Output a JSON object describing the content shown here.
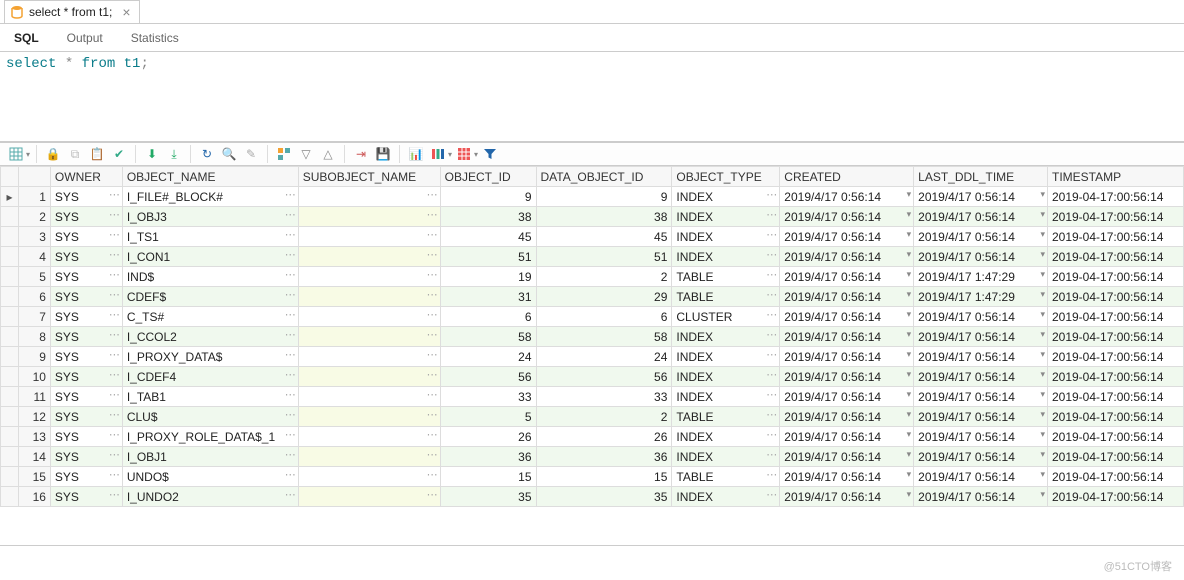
{
  "tab": {
    "title": "select * from t1;"
  },
  "subTabs": [
    "SQL",
    "Output",
    "Statistics"
  ],
  "activeSubTab": 0,
  "sql": {
    "keyword1": "select",
    "star": "*",
    "keyword2": "from",
    "table": "t1",
    "semi": ";"
  },
  "columns": [
    "",
    "",
    "OWNER",
    "OBJECT_NAME",
    "SUBOBJECT_NAME",
    "OBJECT_ID",
    "DATA_OBJECT_ID",
    "OBJECT_TYPE",
    "CREATED",
    "LAST_DDL_TIME",
    "TIMESTAMP"
  ],
  "rows": [
    {
      "n": 1,
      "owner": "SYS",
      "obj": "I_FILE#_BLOCK#",
      "sub": "",
      "oid": 9,
      "doid": 9,
      "type": "INDEX",
      "cr": "2019/4/17 0:56:14",
      "ld": "2019/4/17 0:56:14",
      "ts": "2019-04-17:00:56:14"
    },
    {
      "n": 2,
      "owner": "SYS",
      "obj": "I_OBJ3",
      "sub": "",
      "oid": 38,
      "doid": 38,
      "type": "INDEX",
      "cr": "2019/4/17 0:56:14",
      "ld": "2019/4/17 0:56:14",
      "ts": "2019-04-17:00:56:14"
    },
    {
      "n": 3,
      "owner": "SYS",
      "obj": "I_TS1",
      "sub": "",
      "oid": 45,
      "doid": 45,
      "type": "INDEX",
      "cr": "2019/4/17 0:56:14",
      "ld": "2019/4/17 0:56:14",
      "ts": "2019-04-17:00:56:14"
    },
    {
      "n": 4,
      "owner": "SYS",
      "obj": "I_CON1",
      "sub": "",
      "oid": 51,
      "doid": 51,
      "type": "INDEX",
      "cr": "2019/4/17 0:56:14",
      "ld": "2019/4/17 0:56:14",
      "ts": "2019-04-17:00:56:14"
    },
    {
      "n": 5,
      "owner": "SYS",
      "obj": "IND$",
      "sub": "",
      "oid": 19,
      "doid": 2,
      "type": "TABLE",
      "cr": "2019/4/17 0:56:14",
      "ld": "2019/4/17 1:47:29",
      "ts": "2019-04-17:00:56:14"
    },
    {
      "n": 6,
      "owner": "SYS",
      "obj": "CDEF$",
      "sub": "",
      "oid": 31,
      "doid": 29,
      "type": "TABLE",
      "cr": "2019/4/17 0:56:14",
      "ld": "2019/4/17 1:47:29",
      "ts": "2019-04-17:00:56:14"
    },
    {
      "n": 7,
      "owner": "SYS",
      "obj": "C_TS#",
      "sub": "",
      "oid": 6,
      "doid": 6,
      "type": "CLUSTER",
      "cr": "2019/4/17 0:56:14",
      "ld": "2019/4/17 0:56:14",
      "ts": "2019-04-17:00:56:14"
    },
    {
      "n": 8,
      "owner": "SYS",
      "obj": "I_CCOL2",
      "sub": "",
      "oid": 58,
      "doid": 58,
      "type": "INDEX",
      "cr": "2019/4/17 0:56:14",
      "ld": "2019/4/17 0:56:14",
      "ts": "2019-04-17:00:56:14"
    },
    {
      "n": 9,
      "owner": "SYS",
      "obj": "I_PROXY_DATA$",
      "sub": "",
      "oid": 24,
      "doid": 24,
      "type": "INDEX",
      "cr": "2019/4/17 0:56:14",
      "ld": "2019/4/17 0:56:14",
      "ts": "2019-04-17:00:56:14"
    },
    {
      "n": 10,
      "owner": "SYS",
      "obj": "I_CDEF4",
      "sub": "",
      "oid": 56,
      "doid": 56,
      "type": "INDEX",
      "cr": "2019/4/17 0:56:14",
      "ld": "2019/4/17 0:56:14",
      "ts": "2019-04-17:00:56:14"
    },
    {
      "n": 11,
      "owner": "SYS",
      "obj": "I_TAB1",
      "sub": "",
      "oid": 33,
      "doid": 33,
      "type": "INDEX",
      "cr": "2019/4/17 0:56:14",
      "ld": "2019/4/17 0:56:14",
      "ts": "2019-04-17:00:56:14"
    },
    {
      "n": 12,
      "owner": "SYS",
      "obj": "CLU$",
      "sub": "",
      "oid": 5,
      "doid": 2,
      "type": "TABLE",
      "cr": "2019/4/17 0:56:14",
      "ld": "2019/4/17 0:56:14",
      "ts": "2019-04-17:00:56:14"
    },
    {
      "n": 13,
      "owner": "SYS",
      "obj": "I_PROXY_ROLE_DATA$_1",
      "sub": "",
      "oid": 26,
      "doid": 26,
      "type": "INDEX",
      "cr": "2019/4/17 0:56:14",
      "ld": "2019/4/17 0:56:14",
      "ts": "2019-04-17:00:56:14"
    },
    {
      "n": 14,
      "owner": "SYS",
      "obj": "I_OBJ1",
      "sub": "",
      "oid": 36,
      "doid": 36,
      "type": "INDEX",
      "cr": "2019/4/17 0:56:14",
      "ld": "2019/4/17 0:56:14",
      "ts": "2019-04-17:00:56:14"
    },
    {
      "n": 15,
      "owner": "SYS",
      "obj": "UNDO$",
      "sub": "",
      "oid": 15,
      "doid": 15,
      "type": "TABLE",
      "cr": "2019/4/17 0:56:14",
      "ld": "2019/4/17 0:56:14",
      "ts": "2019-04-17:00:56:14"
    },
    {
      "n": 16,
      "owner": "SYS",
      "obj": "I_UNDO2",
      "sub": "",
      "oid": 35,
      "doid": 35,
      "type": "INDEX",
      "cr": "2019/4/17 0:56:14",
      "ld": "2019/4/17 0:56:14",
      "ts": "2019-04-17:00:56:14"
    }
  ],
  "watermark": "@51CTO博客"
}
